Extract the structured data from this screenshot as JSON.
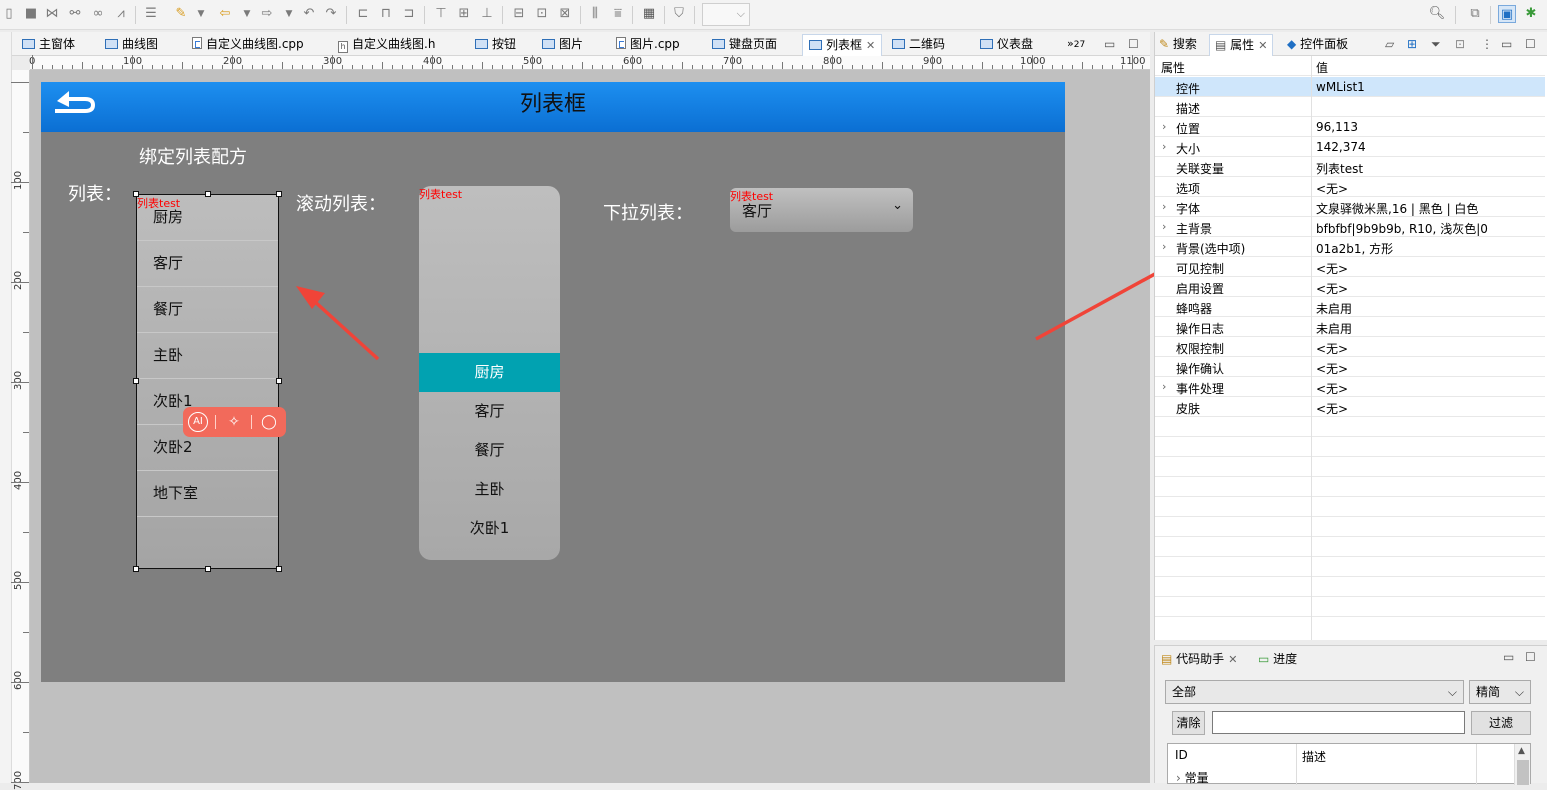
{
  "editor_tabs": [
    {
      "label": "主窗体",
      "icon": "form-icon"
    },
    {
      "label": "曲线图",
      "icon": "form-icon"
    },
    {
      "label": "自定义曲线图.cpp",
      "icon": "cpp-file-icon"
    },
    {
      "label": "自定义曲线图.h",
      "icon": "h-file-icon"
    },
    {
      "label": "按钮",
      "icon": "form-icon"
    },
    {
      "label": "图片",
      "icon": "form-icon"
    },
    {
      "label": "图片.cpp",
      "icon": "cpp-file-icon"
    },
    {
      "label": "键盘页面",
      "icon": "form-icon"
    },
    {
      "label": "列表框",
      "icon": "form-icon",
      "active": true
    },
    {
      "label": "二维码",
      "icon": "form-icon"
    },
    {
      "label": "仪表盘",
      "icon": "form-icon"
    }
  ],
  "tabs_overflow": "27",
  "hruler_labels": [
    "0",
    "100",
    "200",
    "300",
    "400",
    "500",
    "600",
    "700",
    "800",
    "900",
    "1000",
    "1100"
  ],
  "vruler_labels": [
    "100",
    "200",
    "300",
    "400",
    "500",
    "600",
    "700"
  ],
  "screen": {
    "title": "列表框",
    "bind_label": "绑定列表配方",
    "list_label": "列表：",
    "scroll_label": "滚动列表：",
    "dropdown_label": "下拉列表：",
    "var_tag": "列表test"
  },
  "list1_items": [
    "厨房",
    "客厅",
    "餐厅",
    "主卧",
    "次卧1",
    "次卧2",
    "地下室"
  ],
  "scroll_items": [
    "厨房",
    "客厅",
    "餐厅",
    "主卧",
    "次卧1"
  ],
  "dropdown_value": "客厅",
  "right_tabs": [
    "搜索",
    "属性",
    "控件面板"
  ],
  "prop_header": {
    "name": "属性",
    "value": "值"
  },
  "properties": [
    {
      "name": "控件",
      "value": "wMList1",
      "selected": true
    },
    {
      "name": "描述",
      "value": ""
    },
    {
      "name": "位置",
      "value": "96,113",
      "expandable": true
    },
    {
      "name": "大小",
      "value": "142,374",
      "expandable": true
    },
    {
      "name": "关联变量",
      "value": "列表test"
    },
    {
      "name": "选项",
      "value": "<无>"
    },
    {
      "name": "字体",
      "value": "文泉驿微米黑,16 | 黑色 | 白色",
      "expandable": true
    },
    {
      "name": "主背景",
      "value": "bfbfbf|9b9b9b, R10, 浅灰色|0",
      "expandable": true
    },
    {
      "name": "背景(选中项)",
      "value": "01a2b1, 方形",
      "expandable": true
    },
    {
      "name": "可见控制",
      "value": "<无>"
    },
    {
      "name": "启用设置",
      "value": "<无>"
    },
    {
      "name": "蜂鸣器",
      "value": "未启用"
    },
    {
      "name": "操作日志",
      "value": "未启用"
    },
    {
      "name": "权限控制",
      "value": "<无>"
    },
    {
      "name": "操作确认",
      "value": "<无>"
    },
    {
      "name": "事件处理",
      "value": "<无>",
      "expandable": true
    },
    {
      "name": "皮肤",
      "value": "<无>"
    }
  ],
  "bottom_tabs": [
    "代码助手",
    "进度"
  ],
  "code_helper": {
    "scope": "全部",
    "mode": "精简",
    "clear": "清除",
    "filter": "过滤",
    "col_id": "ID",
    "col_desc": "描述",
    "first_row": "常量"
  },
  "colors": {
    "header": "#0b7ad9",
    "selected_item": "#01a2b1",
    "screen_bg": "#7f7f7f",
    "arrow": "#f04438"
  }
}
